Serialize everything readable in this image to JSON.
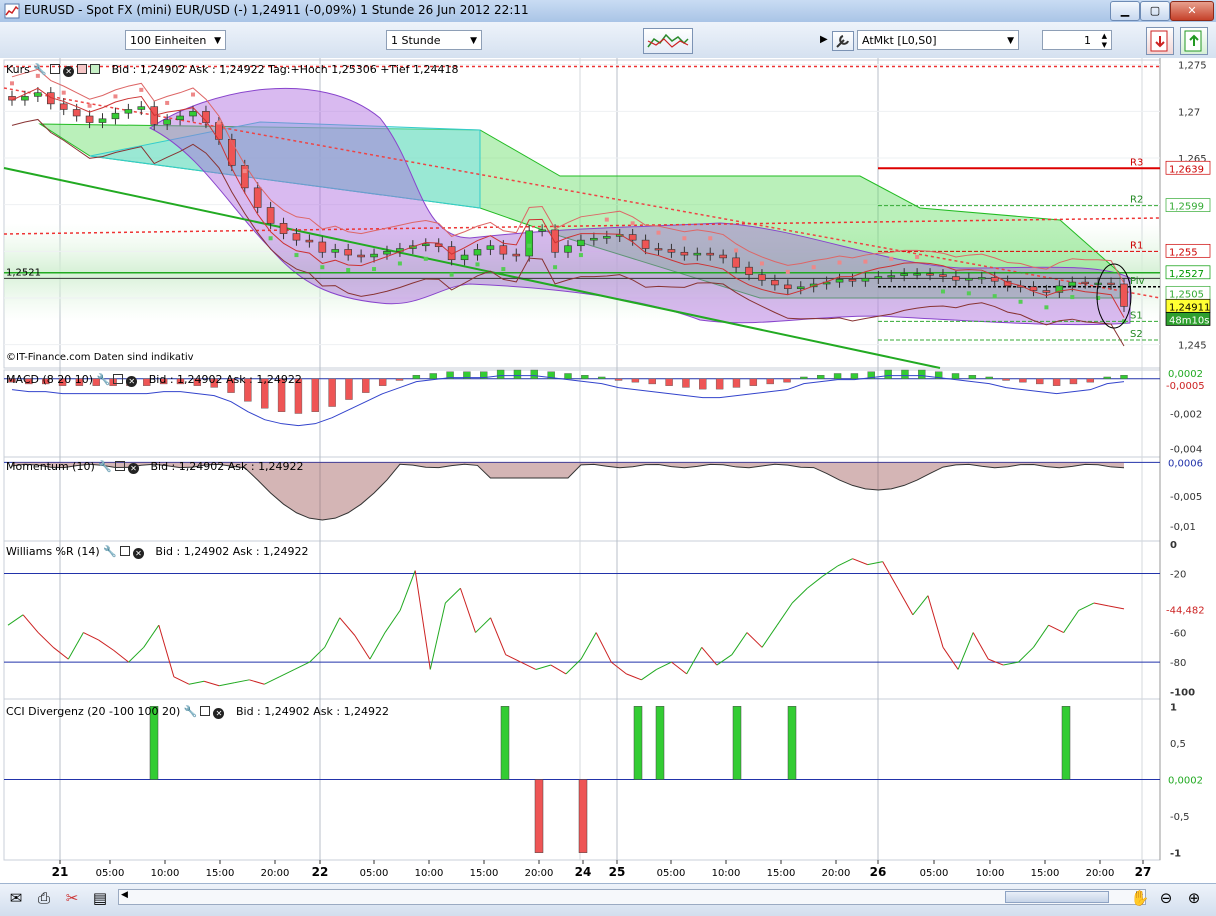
{
  "window": {
    "title": "EURUSD - Spot FX (mini) EUR/USD (-)    1,24911 (-0,09%)    1 Stunde  26 Jun 2012 22:11",
    "min_label": "▁",
    "max_label": "▢",
    "close_label": "✕"
  },
  "toolbar": {
    "units_value": "100 Einheiten",
    "period_value": "1 Stunde",
    "order_type_value": "AtMkt [L0,S0]",
    "quantity_value": "1"
  },
  "panels": {
    "kurs": {
      "title": "Kurs",
      "info": "Bid : 1,24902 Ask : 1,24922 Tag:+Hoch 1,25306 +Tief 1,24418",
      "watermark": "©IT-Finance.com  Daten sind indikativ"
    },
    "macd": {
      "title": "MACD (8 20 10)",
      "info": "Bid : 1,24902 Ask : 1,24922"
    },
    "momentum": {
      "title": "Momentum (10)",
      "info": "Bid : 1,24902 Ask : 1,24922"
    },
    "williams": {
      "title": "Williams %R (14)",
      "info": "Bid : 1,24902 Ask : 1,24922"
    },
    "cci": {
      "title": "CCI Divergenz (20 -100 100 20)",
      "info": "Bid : 1,24902 Ask : 1,24922"
    }
  },
  "price_axis": {
    "ticks": [
      "1,275",
      "1,27",
      "1,265",
      "1,245"
    ],
    "tags": [
      {
        "label": "1,2639",
        "color": "#cc0000"
      },
      {
        "label": "1,2599",
        "color": "#33aa33"
      },
      {
        "label": "1,255",
        "color": "#cc0000"
      },
      {
        "label": "1,2527",
        "color": "#009900"
      },
      {
        "label": "1,2505",
        "color": "#33aa33"
      },
      {
        "label": "1,24911",
        "color": "#000000"
      },
      {
        "label": "48m10s",
        "color": "#009900"
      }
    ],
    "left_label": "1,2521",
    "pivot_labels": [
      "R3",
      "R2",
      "R1",
      "Piv",
      "S1",
      "S2"
    ]
  },
  "macd_axis": {
    "ticks": [
      "-0,002",
      "-0,004"
    ],
    "tags": [
      "0,0002",
      "-0,0005"
    ]
  },
  "momentum_axis": {
    "ticks": [
      "-0,005",
      "-0,01"
    ],
    "tags": [
      "0,0006"
    ]
  },
  "williams_axis": {
    "ticks": [
      "0",
      "-20",
      "-60",
      "-80",
      "-100"
    ],
    "tags": [
      "-44,482"
    ]
  },
  "cci_axis": {
    "ticks": [
      "1",
      "0,5",
      "-0,5",
      "-1"
    ],
    "tags": [
      "0,0002"
    ]
  },
  "time_axis": [
    "21",
    "05:00",
    "10:00",
    "15:00",
    "20:00",
    "22",
    "05:00",
    "10:00",
    "15:00",
    "20:00",
    "24",
    "25",
    "05:00",
    "10:00",
    "15:00",
    "20:00",
    "26",
    "05:00",
    "10:00",
    "15:00",
    "20:00",
    "27"
  ],
  "colors": {
    "up": "#33cc33",
    "down": "#ee5555",
    "ichimoku_cloud": "#66dd66",
    "bollinger": "#aa66dd",
    "pivot_r": "#dd0000",
    "pivot_s": "#33aa33"
  },
  "chart_data": [
    {
      "type": "candlestick",
      "title": "Kurs",
      "ylim": [
        1.2425,
        1.2755
      ],
      "close_series": [
        1.2712,
        1.2716,
        1.272,
        1.2708,
        1.2702,
        1.2695,
        1.2688,
        1.2692,
        1.2698,
        1.2702,
        1.2705,
        1.2686,
        1.2691,
        1.2695,
        1.27,
        1.2688,
        1.267,
        1.2642,
        1.2618,
        1.2597,
        1.258,
        1.2569,
        1.2562,
        1.256,
        1.2549,
        1.2552,
        1.2546,
        1.2544,
        1.2547,
        1.255,
        1.2553,
        1.2556,
        1.2558,
        1.2555,
        1.2541,
        1.2546,
        1.2552,
        1.2556,
        1.2547,
        1.2545,
        1.2572,
        1.2573,
        1.2549,
        1.2556,
        1.2562,
        1.2564,
        1.2566,
        1.2568,
        1.2562,
        1.2553,
        1.2552,
        1.2549,
        1.2546,
        1.2548,
        1.2546,
        1.2543,
        1.2533,
        1.2525,
        1.2519,
        1.2514,
        1.251,
        1.2512,
        1.2515,
        1.2517,
        1.252,
        1.2518,
        1.2521,
        1.2523,
        1.2524,
        1.2526,
        1.2526,
        1.2525,
        1.2523,
        1.2519,
        1.2521,
        1.2522,
        1.2518,
        1.2513,
        1.2512,
        1.2508,
        1.2506,
        1.2513,
        1.2517,
        1.2516,
        1.2516,
        1.2515,
        1.2491
      ],
      "last": 1.24911,
      "pivots": {
        "R3": 1.2639,
        "R2": 1.2599,
        "R1": 1.255,
        "S1": 1.2475,
        "S2": 1.2455
      }
    },
    {
      "type": "bar",
      "title": "MACD (8 20 10)",
      "ylim": [
        -0.0045,
        0.0005
      ],
      "histogram": [
        -0.0002,
        -0.0003,
        -0.0003,
        -0.0004,
        -0.0004,
        -0.0004,
        -0.0004,
        -0.0004,
        -0.0004,
        -0.0003,
        -0.0003,
        -0.0004,
        -0.0005,
        -0.0008,
        -0.0013,
        -0.0017,
        -0.0019,
        -0.002,
        -0.0019,
        -0.0016,
        -0.0012,
        -0.0008,
        -0.0004,
        -0.0001,
        0.0002,
        0.0003,
        0.0004,
        0.0004,
        0.0004,
        0.0005,
        0.0005,
        0.0005,
        0.0004,
        0.0003,
        0.0002,
        0.0001,
        -0.0001,
        -0.0002,
        -0.0003,
        -0.0004,
        -0.0005,
        -0.0006,
        -0.0006,
        -0.0005,
        -0.0004,
        -0.0003,
        -0.0002,
        0.0001,
        0.0002,
        0.0003,
        0.0003,
        0.0004,
        0.0005,
        0.0005,
        0.0005,
        0.0004,
        0.0003,
        0.0002,
        0.0001,
        -0.0001,
        -0.0002,
        -0.0003,
        -0.0004,
        -0.0003,
        -0.0002,
        0.0001,
        0.0002
      ]
    },
    {
      "type": "area",
      "title": "Momentum (10)",
      "ylim": [
        -0.0125,
        0.0015
      ]
    },
    {
      "type": "line",
      "title": "Williams %R (14)",
      "ylim": [
        -105,
        2
      ],
      "levels": [
        -20,
        -80
      ],
      "last": -44.482
    },
    {
      "type": "bar",
      "title": "CCI Divergenz (20 -100 100 20)",
      "ylim": [
        -1.1,
        1.1
      ],
      "signals": [
        1,
        1,
        1,
        1,
        1,
        1,
        1,
        -1,
        -1
      ]
    }
  ]
}
